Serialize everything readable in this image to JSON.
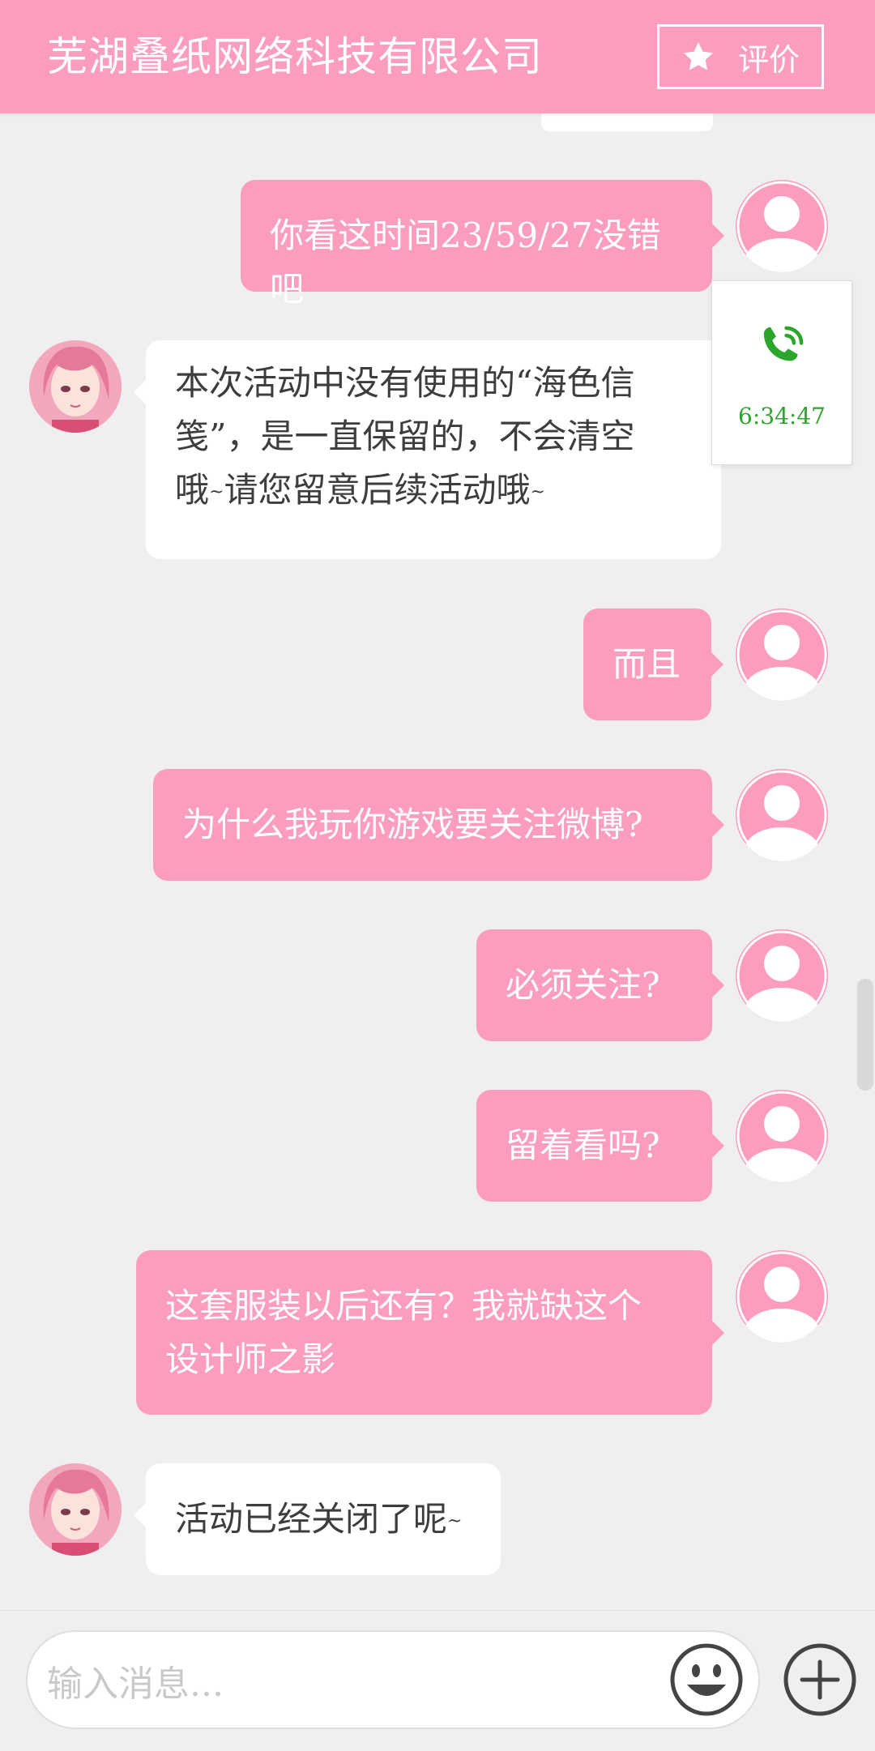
{
  "header": {
    "title": "芜湖叠纸网络科技有限公司",
    "rate_label": "评价"
  },
  "call_card": {
    "duration": "6:34:47",
    "icon": "phone-call-icon",
    "color": "#2ca52c"
  },
  "messages": [
    {
      "side": "user",
      "text": "你看这时间23/59/27没错吧"
    },
    {
      "side": "agent",
      "lines": [
        "本次活动中没有使用的“海色信",
        "笺”，是一直保留的，不会清空",
        "哦"
      ],
      "line3_tail": "请您留意后续活动哦"
    },
    {
      "side": "user",
      "text": "而且"
    },
    {
      "side": "user",
      "text": "为什么我玩你游戏要关注微博?"
    },
    {
      "side": "user",
      "text": "必须关注?"
    },
    {
      "side": "user",
      "text": "留着看吗?"
    },
    {
      "side": "user",
      "lines": [
        "这套服装以后还有？我就缺这个",
        "设计师之影"
      ]
    },
    {
      "side": "agent",
      "text": "活动已经关闭了呢"
    }
  ],
  "tilde": "~",
  "input": {
    "placeholder": "输入消息..."
  },
  "colors": {
    "brand_pink": "#fc9cbf",
    "background": "#efeff1",
    "agent_bubble": "#ffffff"
  }
}
